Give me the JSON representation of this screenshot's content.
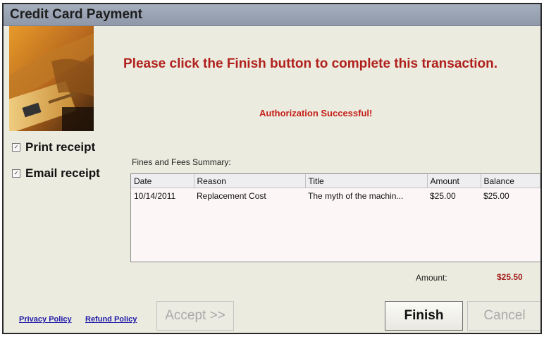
{
  "window": {
    "title": "Credit Card Payment"
  },
  "header": {
    "instruction": "Please click the Finish button to complete this transaction.",
    "status": "Authorization Successful!"
  },
  "options": [
    {
      "label": "Print receipt",
      "checked": true
    },
    {
      "label": "Email receipt",
      "checked": true
    }
  ],
  "summary": {
    "label": "Fines and Fees Summary:",
    "columns": [
      "Date",
      "Reason",
      "Title",
      "Amount",
      "Balance"
    ],
    "rows": [
      [
        "10/14/2011",
        "Replacement Cost",
        "The myth of the machin...",
        "$25.00",
        "$25.00"
      ]
    ]
  },
  "total": {
    "label": "Amount:",
    "value": "$25.50"
  },
  "footer": {
    "privacy_link": "Privacy Policy",
    "refund_link": "Refund Policy",
    "accept_label": "Accept >>",
    "finish_label": "Finish",
    "cancel_label": "Cancel"
  },
  "colors": {
    "alert_red": "#c41e17",
    "link_blue": "#1e1aa8",
    "panel_bg": "#ecebdf"
  },
  "icons": {
    "card_photo": "credit-card-photo"
  }
}
